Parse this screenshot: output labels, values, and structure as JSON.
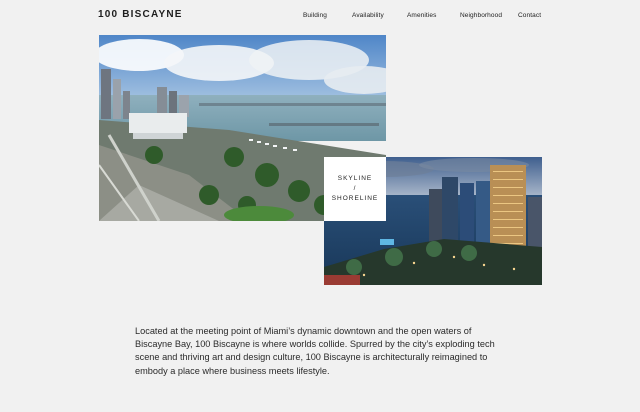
{
  "header": {
    "brand": "100 BISCAYNE",
    "nav": [
      "Building",
      "Availability",
      "Amenities",
      "Neighborhood",
      "Contact"
    ]
  },
  "gallery": {
    "caption_line1": "SKYLINE",
    "caption_line2": "/",
    "caption_line3": "SHORELINE"
  },
  "intro": {
    "text": "Located at the meeting point of Miami’s dynamic downtown and the open waters of Biscayne Bay, 100 Biscayne is where worlds collide. Spurred by the city’s exploding tech scene and thriving art and design culture, 100 Biscayne is architecturally reimagined to embody a place where business meets lifestyle."
  }
}
